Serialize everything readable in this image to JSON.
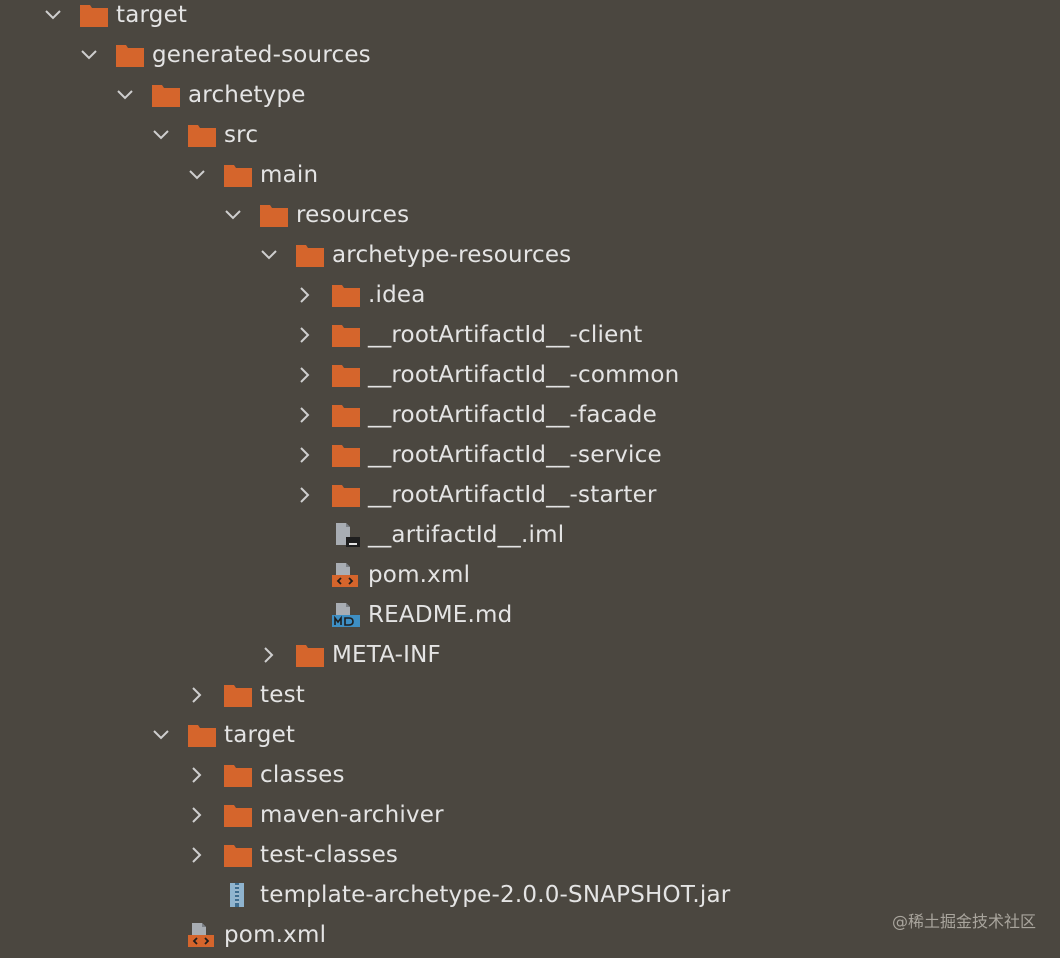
{
  "tree": {
    "rows": [
      {
        "label": "target",
        "icon": "folder-icon",
        "state": "expanded"
      },
      {
        "label": "generated-sources",
        "icon": "folder-icon",
        "state": "expanded"
      },
      {
        "label": "archetype",
        "icon": "folder-icon",
        "state": "expanded"
      },
      {
        "label": "src",
        "icon": "folder-icon",
        "state": "expanded"
      },
      {
        "label": "main",
        "icon": "folder-icon",
        "state": "expanded"
      },
      {
        "label": "resources",
        "icon": "folder-icon",
        "state": "expanded"
      },
      {
        "label": "archetype-resources",
        "icon": "folder-icon",
        "state": "expanded"
      },
      {
        "label": ".idea",
        "icon": "folder-icon",
        "state": "collapsed"
      },
      {
        "label": "__rootArtifactId__-client",
        "icon": "folder-icon",
        "state": "collapsed"
      },
      {
        "label": "__rootArtifactId__-common",
        "icon": "folder-icon",
        "state": "collapsed"
      },
      {
        "label": "__rootArtifactId__-facade",
        "icon": "folder-icon",
        "state": "collapsed"
      },
      {
        "label": "__rootArtifactId__-service",
        "icon": "folder-icon",
        "state": "collapsed"
      },
      {
        "label": "__rootArtifactId__-starter",
        "icon": "folder-icon",
        "state": "collapsed"
      },
      {
        "label": "__artifactId__.iml",
        "icon": "iml-file-icon",
        "state": "leaf"
      },
      {
        "label": "pom.xml",
        "icon": "xml-file-icon",
        "state": "leaf"
      },
      {
        "label": "README.md",
        "icon": "markdown-file-icon",
        "state": "leaf"
      },
      {
        "label": "META-INF",
        "icon": "folder-icon",
        "state": "collapsed"
      },
      {
        "label": "test",
        "icon": "folder-icon",
        "state": "collapsed"
      },
      {
        "label": "target",
        "icon": "folder-icon",
        "state": "expanded"
      },
      {
        "label": "classes",
        "icon": "folder-icon",
        "state": "collapsed"
      },
      {
        "label": "maven-archiver",
        "icon": "folder-icon",
        "state": "collapsed"
      },
      {
        "label": "test-classes",
        "icon": "folder-icon",
        "state": "collapsed"
      },
      {
        "label": "template-archetype-2.0.0-SNAPSHOT.jar",
        "icon": "jar-file-icon",
        "state": "leaf"
      },
      {
        "label": "pom.xml",
        "icon": "xml-file-icon",
        "state": "leaf"
      }
    ]
  },
  "watermark": "@稀土掘金技术社区",
  "colors": {
    "background": "#4b4740",
    "folder": "#d5652c",
    "text": "#e4e4e4",
    "chevron": "#cfcfcf",
    "file_gray": "#a8adb3",
    "markdown_blue": "#3e8fc4"
  }
}
